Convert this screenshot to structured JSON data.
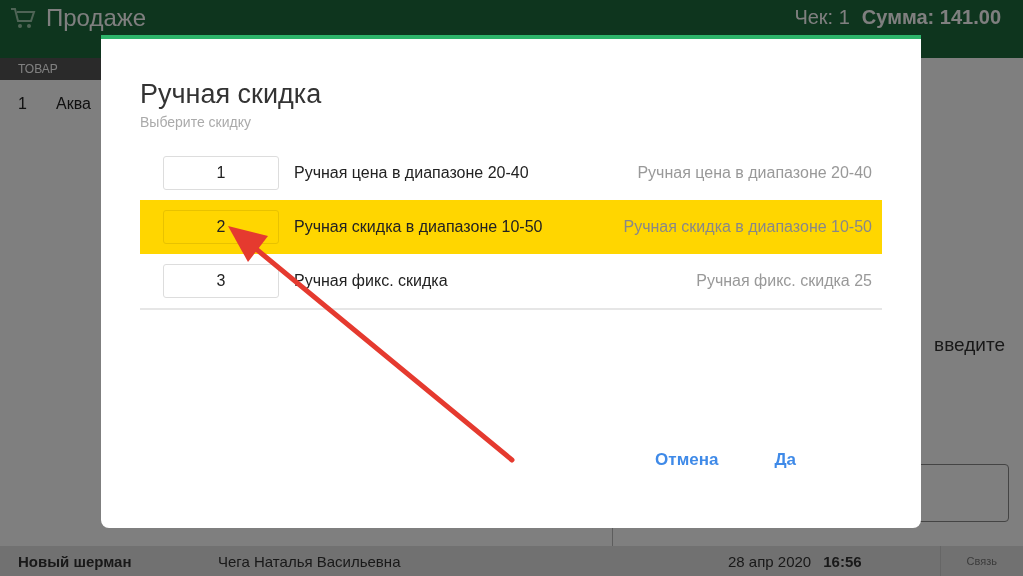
{
  "header": {
    "title": "Продаже",
    "receipt": "Чек: 1",
    "total": "Сумма: 141.00"
  },
  "table": {
    "columns": [
      "ТОВАР"
    ],
    "rows": [
      {
        "number": "1",
        "name": "Аква"
      }
    ]
  },
  "side_panel": {
    "hint": "введите"
  },
  "dialog": {
    "title": "Ручная скидка",
    "subtitle": "Выберите скидку",
    "options": [
      {
        "code": "1",
        "name": "Ручная цена в диапазоне 20-40",
        "description": "Ручная цена в диапазоне 20-40",
        "selected": false
      },
      {
        "code": "2",
        "name": "Ручная скидка в диапазоне 10-50",
        "description": "Ручная скидка в диапазоне 10-50",
        "selected": true
      },
      {
        "code": "3",
        "name": "Ручная фикс. скидка",
        "description": "Ручная фикс. скидка 25",
        "selected": false
      }
    ],
    "buttons": [
      "Отмена",
      "Да"
    ]
  },
  "status_bar": {
    "store": "Новый шерман",
    "cashier": "Чега Наталья Васильевна",
    "date": "28 апр 2020",
    "time": "16:56",
    "connection": "Связь"
  }
}
